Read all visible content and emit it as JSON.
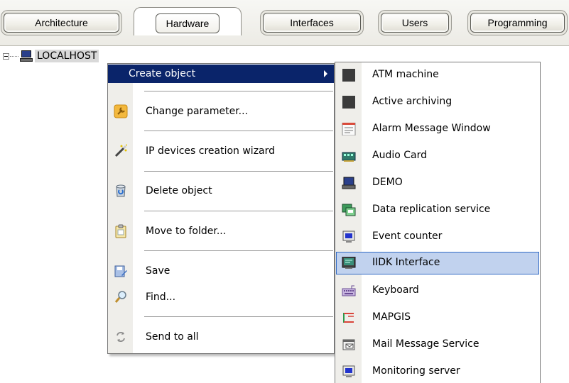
{
  "tabs": [
    {
      "label": "Architecture",
      "active": false
    },
    {
      "label": "Hardware",
      "active": true
    },
    {
      "label": "Interfaces",
      "active": false
    },
    {
      "label": "Users",
      "active": false
    },
    {
      "label": "Programming",
      "active": false
    }
  ],
  "tree": {
    "root_label": "LOCALHOST",
    "root_icon": "computer-icon"
  },
  "context_menu": {
    "items": [
      {
        "label": "Create object",
        "icon": "none",
        "has_submenu": true,
        "highlighted": true
      },
      {
        "label": "Change parameter...",
        "icon": "wrench-icon"
      },
      {
        "label": "IP devices creation wizard",
        "icon": "magic-wand-icon"
      },
      {
        "label": "Delete object",
        "icon": "recycle-bin-icon"
      },
      {
        "label": "Move to folder...",
        "icon": "clipboard-folder-icon"
      },
      {
        "label": "Save",
        "icon": "save-icon"
      },
      {
        "label": "Find...",
        "icon": "magnifier-icon"
      },
      {
        "label": "Send to all",
        "icon": "refresh-arrows-icon"
      }
    ]
  },
  "submenu": {
    "items": [
      {
        "label": "ATM machine",
        "icon": "dark-square-icon"
      },
      {
        "label": "Active archiving",
        "icon": "dark-square-icon"
      },
      {
        "label": "Alarm Message Window",
        "icon": "message-window-icon"
      },
      {
        "label": "Audio Card",
        "icon": "audio-card-icon"
      },
      {
        "label": "DEMO",
        "icon": "laptop-icon"
      },
      {
        "label": "Data replication service",
        "icon": "replication-icon"
      },
      {
        "label": "Event counter",
        "icon": "counter-monitor-icon"
      },
      {
        "label": "IIDK Interface",
        "icon": "interface-monitor-icon",
        "selected": true
      },
      {
        "label": "Keyboard",
        "icon": "keyboard-icon"
      },
      {
        "label": "MAPGIS",
        "icon": "map-frame-icon"
      },
      {
        "label": "Mail Message Service",
        "icon": "mail-service-icon"
      },
      {
        "label": "Monitoring server",
        "icon": "monitor-icon"
      }
    ]
  },
  "colors": {
    "menu_highlight": "#0a246a",
    "submenu_selection": "#c1d2ee",
    "submenu_selection_border": "#316ac5"
  }
}
